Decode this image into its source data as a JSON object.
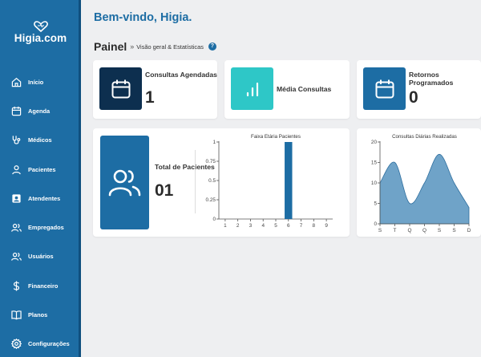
{
  "sidebar": {
    "brand": "Higia.com",
    "items": [
      {
        "label": "Início",
        "icon": "home-icon"
      },
      {
        "label": "Agenda",
        "icon": "calendar-icon"
      },
      {
        "label": "Médicos",
        "icon": "stethoscope-icon"
      },
      {
        "label": "Pacientes",
        "icon": "user-icon"
      },
      {
        "label": "Atendentes",
        "icon": "id-badge-icon"
      },
      {
        "label": "Empregados",
        "icon": "users-icon"
      },
      {
        "label": "Usuários",
        "icon": "user-group-icon"
      },
      {
        "label": "Financeiro",
        "icon": "dollar-icon"
      },
      {
        "label": "Planos",
        "icon": "book-icon"
      },
      {
        "label": "Configurações",
        "icon": "gear-icon"
      }
    ]
  },
  "header": {
    "greeting": "Bem-vindo, Higia.",
    "title": "Painel",
    "separator": "»",
    "subtitle": "Visão geral & Estatísticas",
    "help": "?"
  },
  "stats": {
    "consultas_label": "Consultas Agendadas",
    "consultas_value": "1",
    "media_label": "Média Consultas",
    "retornos_label": "Retornos Programados",
    "retornos_value": "0"
  },
  "patients": {
    "label": "Total de Pacientes",
    "value": "01"
  },
  "colors": {
    "primary": "#1d6da4",
    "dark_navy": "#0d2f4f",
    "teal": "#2ec7c7",
    "area_fill": "#6fa3c8"
  },
  "chart_data": [
    {
      "type": "bar",
      "title": "Faixa Etária Pacientes",
      "categories": [
        "1",
        "2",
        "3",
        "4",
        "5",
        "6",
        "7",
        "8",
        "9"
      ],
      "values": [
        0,
        0,
        0,
        0,
        0,
        1,
        0,
        0,
        0
      ],
      "ylim": [
        0,
        1
      ],
      "yticks": [
        "0",
        "0.25",
        "0.5",
        "0.75",
        "1"
      ],
      "grid": false
    },
    {
      "type": "area",
      "title": "Consultas Diárias Realizadas",
      "categories": [
        "S",
        "T",
        "Q",
        "Q",
        "S",
        "S",
        "D"
      ],
      "values": [
        10,
        15,
        5,
        10,
        17,
        10,
        4
      ],
      "ylim": [
        0,
        20
      ],
      "yticks": [
        "0",
        "5",
        "10",
        "15",
        "20"
      ],
      "grid": false
    }
  ]
}
